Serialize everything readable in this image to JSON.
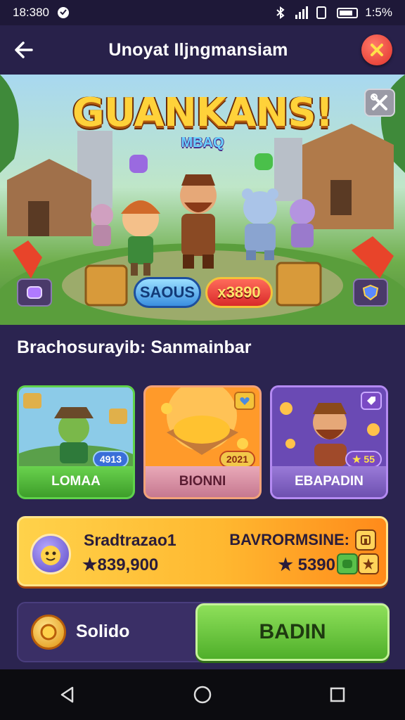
{
  "status_bar": {
    "time": "18:380",
    "battery_text": "1:5%"
  },
  "header": {
    "title": "Unoyat Iljngmansiam"
  },
  "banner": {
    "game_title": "GUANKANS!",
    "game_subtitle": "MBAQ",
    "pill_blue": "SAOUS",
    "pill_red": "x3890"
  },
  "section": {
    "title": "Brachosurayib: Sanmainbar"
  },
  "cards": [
    {
      "label": "LOMAA",
      "badge": "4913"
    },
    {
      "label": "BIONNI",
      "badge": "2021"
    },
    {
      "label": "EBAPADIN",
      "badge": "★ 55"
    }
  ],
  "reward": {
    "name": "Sradtrazao1",
    "value": "★839,900",
    "bonus_title": "BAVRORMSINE:",
    "bonus_value": "★ 5390"
  },
  "action": {
    "label": "Solido",
    "button": "BADIN"
  },
  "colors": {
    "background": "#2b2450",
    "accent_green": "#4faf2a",
    "accent_gold": "#ffd24a",
    "close_red": "#e0322a"
  }
}
